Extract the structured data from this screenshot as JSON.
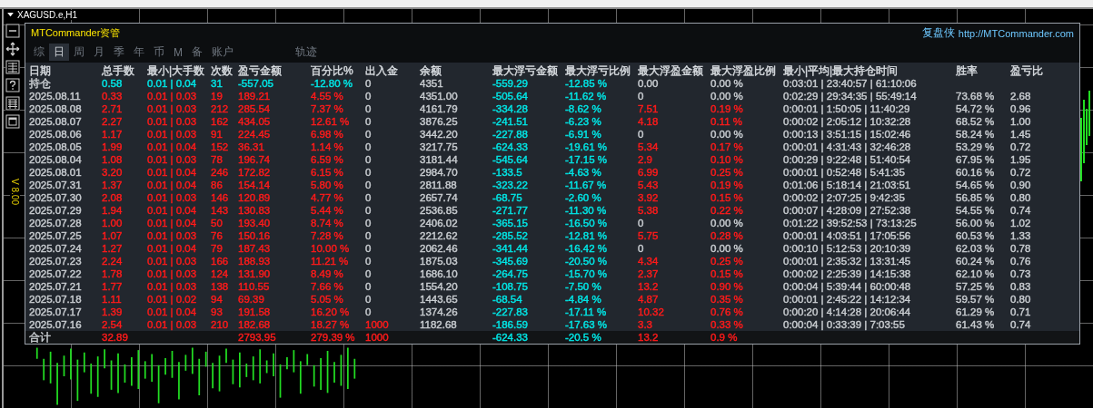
{
  "chart": {
    "title": "XAGUSD.e,H1",
    "volume_label": "V 8.00"
  },
  "panel": {
    "title": "MTCommander资管",
    "brand": "复盘侠",
    "link": "http://MTCommander.com"
  },
  "tabs": [
    {
      "label": "综",
      "selected": false
    },
    {
      "label": "日",
      "selected": true
    },
    {
      "label": "周",
      "selected": false
    },
    {
      "label": "月",
      "selected": false
    },
    {
      "label": "季",
      "selected": false
    },
    {
      "label": "年",
      "selected": false
    },
    {
      "label": "币",
      "selected": false
    },
    {
      "label": "M",
      "selected": false
    },
    {
      "label": "备",
      "selected": false
    },
    {
      "label": "账户",
      "selected": false
    },
    {
      "label": "轨迹",
      "selected": false
    }
  ],
  "table": {
    "columns": [
      "日期",
      "总手数",
      "最小|大手数",
      "次数",
      "盈亏金额",
      "百分比%",
      "出入金",
      "余额",
      "最大浮亏金额",
      "最大浮亏比例",
      "最大浮盈金额",
      "最大浮盈比例",
      "最小|平均|最大持仓时间",
      "胜率",
      "盈亏比"
    ],
    "rows": [
      {
        "kind": "position",
        "date": {
          "text": "持仓",
          "color": "#c8ccd0"
        },
        "lots": {
          "text": "0.58",
          "color": "#00e5e5"
        },
        "lot_range": {
          "text": "0.01 | 0.04",
          "color": "#00e5e5"
        },
        "trades": {
          "text": "31",
          "color": "#00e5e5"
        },
        "profit": {
          "text": "-557.05",
          "color": "#00e5e5"
        },
        "percent": {
          "text": "-12.80 %",
          "color": "#00e5e5"
        },
        "deposit": {
          "text": "0",
          "color": "#c8ccd0"
        },
        "balance": {
          "text": "4351",
          "color": "#c8ccd0"
        },
        "float_loss": {
          "text": "-559.29",
          "color": "#00e5e5"
        },
        "float_loss_pct": {
          "text": "-12.85 %",
          "color": "#00e5e5"
        },
        "float_profit": {
          "text": "0.00",
          "color": "#c8ccd0"
        },
        "float_profit_pct": {
          "text": "0.00 %",
          "color": "#c8ccd0"
        },
        "hold_times": {
          "text": "0:03:01 | 23:40:57 | 61:10:06",
          "color": "#c8ccd0"
        }
      },
      {
        "kind": "day",
        "date": {
          "text": "2025.08.11",
          "color": "#c8ccd0"
        },
        "lots": {
          "text": "0.33",
          "color": "#ff1a1a"
        },
        "lot_range": {
          "text": "0.01 | 0.03",
          "color": "#ff1a1a"
        },
        "trades": {
          "text": "19",
          "color": "#ff1a1a"
        },
        "profit": {
          "text": "189.21",
          "color": "#ff1a1a"
        },
        "percent": {
          "text": "4.55 %",
          "color": "#ff1a1a"
        },
        "deposit": {
          "text": "0",
          "color": "#c8ccd0"
        },
        "balance": {
          "text": "4351.00",
          "color": "#c8ccd0"
        },
        "float_loss": {
          "text": "-505.64",
          "color": "#00e5e5"
        },
        "float_loss_pct": {
          "text": "-11.62 %",
          "color": "#00e5e5"
        },
        "float_profit": {
          "text": "0",
          "color": "#c8ccd0"
        },
        "float_profit_pct": {
          "text": "0.00 %",
          "color": "#c8ccd0"
        },
        "hold_times": {
          "text": "0:02:29 | 29:34:35 | 55:49:14",
          "color": "#c8ccd0"
        },
        "win_rate": {
          "text": "73.68 %",
          "color": "#c8ccd0"
        },
        "ratio": {
          "text": "2.68",
          "color": "#c8ccd0"
        }
      },
      {
        "kind": "day",
        "date": {
          "text": "2025.08.08",
          "color": "#c8ccd0"
        },
        "lots": {
          "text": "2.71",
          "color": "#ff1a1a"
        },
        "lot_range": {
          "text": "0.01 | 0.03",
          "color": "#ff1a1a"
        },
        "trades": {
          "text": "212",
          "color": "#ff1a1a"
        },
        "profit": {
          "text": "285.54",
          "color": "#ff1a1a"
        },
        "percent": {
          "text": "7.37 %",
          "color": "#ff1a1a"
        },
        "deposit": {
          "text": "0",
          "color": "#c8ccd0"
        },
        "balance": {
          "text": "4161.79",
          "color": "#c8ccd0"
        },
        "float_loss": {
          "text": "-334.28",
          "color": "#00e5e5"
        },
        "float_loss_pct": {
          "text": "-8.62 %",
          "color": "#00e5e5"
        },
        "float_profit": {
          "text": "7.51",
          "color": "#ff1a1a"
        },
        "float_profit_pct": {
          "text": "0.19 %",
          "color": "#ff1a1a"
        },
        "hold_times": {
          "text": "0:00:01 | 1:50:05 | 11:40:29",
          "color": "#c8ccd0"
        },
        "win_rate": {
          "text": "54.72 %",
          "color": "#c8ccd0"
        },
        "ratio": {
          "text": "0.96",
          "color": "#c8ccd0"
        }
      },
      {
        "kind": "day",
        "date": {
          "text": "2025.08.07",
          "color": "#c8ccd0"
        },
        "lots": {
          "text": "2.27",
          "color": "#ff1a1a"
        },
        "lot_range": {
          "text": "0.01 | 0.03",
          "color": "#ff1a1a"
        },
        "trades": {
          "text": "162",
          "color": "#ff1a1a"
        },
        "profit": {
          "text": "434.05",
          "color": "#ff1a1a"
        },
        "percent": {
          "text": "12.61 %",
          "color": "#ff1a1a"
        },
        "deposit": {
          "text": "0",
          "color": "#c8ccd0"
        },
        "balance": {
          "text": "3876.25",
          "color": "#c8ccd0"
        },
        "float_loss": {
          "text": "-241.51",
          "color": "#00e5e5"
        },
        "float_loss_pct": {
          "text": "-6.23 %",
          "color": "#00e5e5"
        },
        "float_profit": {
          "text": "4.18",
          "color": "#ff1a1a"
        },
        "float_profit_pct": {
          "text": "0.11 %",
          "color": "#ff1a1a"
        },
        "hold_times": {
          "text": "0:00:02 | 2:05:12 | 10:32:28",
          "color": "#c8ccd0"
        },
        "win_rate": {
          "text": "68.52 %",
          "color": "#c8ccd0"
        },
        "ratio": {
          "text": "1.00",
          "color": "#c8ccd0"
        }
      },
      {
        "kind": "day",
        "date": {
          "text": "2025.08.06",
          "color": "#c8ccd0"
        },
        "lots": {
          "text": "1.17",
          "color": "#ff1a1a"
        },
        "lot_range": {
          "text": "0.01 | 0.03",
          "color": "#ff1a1a"
        },
        "trades": {
          "text": "91",
          "color": "#ff1a1a"
        },
        "profit": {
          "text": "224.45",
          "color": "#ff1a1a"
        },
        "percent": {
          "text": "6.98 %",
          "color": "#ff1a1a"
        },
        "deposit": {
          "text": "0",
          "color": "#c8ccd0"
        },
        "balance": {
          "text": "3442.20",
          "color": "#c8ccd0"
        },
        "float_loss": {
          "text": "-227.88",
          "color": "#00e5e5"
        },
        "float_loss_pct": {
          "text": "-6.91 %",
          "color": "#00e5e5"
        },
        "float_profit": {
          "text": "0",
          "color": "#c8ccd0"
        },
        "float_profit_pct": {
          "text": "0.00 %",
          "color": "#c8ccd0"
        },
        "hold_times": {
          "text": "0:00:13 | 3:51:15 | 15:02:46",
          "color": "#c8ccd0"
        },
        "win_rate": {
          "text": "58.24 %",
          "color": "#c8ccd0"
        },
        "ratio": {
          "text": "1.45",
          "color": "#c8ccd0"
        }
      },
      {
        "kind": "day",
        "date": {
          "text": "2025.08.05",
          "color": "#c8ccd0"
        },
        "lots": {
          "text": "1.99",
          "color": "#ff1a1a"
        },
        "lot_range": {
          "text": "0.01 | 0.04",
          "color": "#ff1a1a"
        },
        "trades": {
          "text": "152",
          "color": "#ff1a1a"
        },
        "profit": {
          "text": "36.31",
          "color": "#ff1a1a"
        },
        "percent": {
          "text": "1.14 %",
          "color": "#ff1a1a"
        },
        "deposit": {
          "text": "0",
          "color": "#c8ccd0"
        },
        "balance": {
          "text": "3217.75",
          "color": "#c8ccd0"
        },
        "float_loss": {
          "text": "-624.33",
          "color": "#00e5e5"
        },
        "float_loss_pct": {
          "text": "-19.61 %",
          "color": "#00e5e5"
        },
        "float_profit": {
          "text": "5.34",
          "color": "#ff1a1a"
        },
        "float_profit_pct": {
          "text": "0.17 %",
          "color": "#ff1a1a"
        },
        "hold_times": {
          "text": "0:00:01 | 4:31:43 | 32:46:28",
          "color": "#c8ccd0"
        },
        "win_rate": {
          "text": "53.29 %",
          "color": "#c8ccd0"
        },
        "ratio": {
          "text": "0.72",
          "color": "#c8ccd0"
        }
      },
      {
        "kind": "day",
        "date": {
          "text": "2025.08.04",
          "color": "#c8ccd0"
        },
        "lots": {
          "text": "1.08",
          "color": "#ff1a1a"
        },
        "lot_range": {
          "text": "0.01 | 0.03",
          "color": "#ff1a1a"
        },
        "trades": {
          "text": "78",
          "color": "#ff1a1a"
        },
        "profit": {
          "text": "196.74",
          "color": "#ff1a1a"
        },
        "percent": {
          "text": "6.59 %",
          "color": "#ff1a1a"
        },
        "deposit": {
          "text": "0",
          "color": "#c8ccd0"
        },
        "balance": {
          "text": "3181.44",
          "color": "#c8ccd0"
        },
        "float_loss": {
          "text": "-545.64",
          "color": "#00e5e5"
        },
        "float_loss_pct": {
          "text": "-17.15 %",
          "color": "#00e5e5"
        },
        "float_profit": {
          "text": "2.9",
          "color": "#ff1a1a"
        },
        "float_profit_pct": {
          "text": "0.10 %",
          "color": "#ff1a1a"
        },
        "hold_times": {
          "text": "0:00:29 | 9:22:48 | 51:40:54",
          "color": "#c8ccd0"
        },
        "win_rate": {
          "text": "67.95 %",
          "color": "#c8ccd0"
        },
        "ratio": {
          "text": "1.95",
          "color": "#c8ccd0"
        }
      },
      {
        "kind": "day",
        "date": {
          "text": "2025.08.01",
          "color": "#c8ccd0"
        },
        "lots": {
          "text": "3.20",
          "color": "#ff1a1a"
        },
        "lot_range": {
          "text": "0.01 | 0.04",
          "color": "#ff1a1a"
        },
        "trades": {
          "text": "246",
          "color": "#ff1a1a"
        },
        "profit": {
          "text": "172.82",
          "color": "#ff1a1a"
        },
        "percent": {
          "text": "6.15 %",
          "color": "#ff1a1a"
        },
        "deposit": {
          "text": "0",
          "color": "#c8ccd0"
        },
        "balance": {
          "text": "2984.70",
          "color": "#c8ccd0"
        },
        "float_loss": {
          "text": "-133.5",
          "color": "#00e5e5"
        },
        "float_loss_pct": {
          "text": "-4.63 %",
          "color": "#00e5e5"
        },
        "float_profit": {
          "text": "6.99",
          "color": "#ff1a1a"
        },
        "float_profit_pct": {
          "text": "0.25 %",
          "color": "#ff1a1a"
        },
        "hold_times": {
          "text": "0:00:01 | 0:52:48 | 5:41:35",
          "color": "#c8ccd0"
        },
        "win_rate": {
          "text": "60.16 %",
          "color": "#c8ccd0"
        },
        "ratio": {
          "text": "0.72",
          "color": "#c8ccd0"
        }
      },
      {
        "kind": "day",
        "date": {
          "text": "2025.07.31",
          "color": "#c8ccd0"
        },
        "lots": {
          "text": "1.37",
          "color": "#ff1a1a"
        },
        "lot_range": {
          "text": "0.01 | 0.04",
          "color": "#ff1a1a"
        },
        "trades": {
          "text": "86",
          "color": "#ff1a1a"
        },
        "profit": {
          "text": "154.14",
          "color": "#ff1a1a"
        },
        "percent": {
          "text": "5.80 %",
          "color": "#ff1a1a"
        },
        "deposit": {
          "text": "0",
          "color": "#c8ccd0"
        },
        "balance": {
          "text": "2811.88",
          "color": "#c8ccd0"
        },
        "float_loss": {
          "text": "-323.22",
          "color": "#00e5e5"
        },
        "float_loss_pct": {
          "text": "-11.67 %",
          "color": "#00e5e5"
        },
        "float_profit": {
          "text": "5.43",
          "color": "#ff1a1a"
        },
        "float_profit_pct": {
          "text": "0.19 %",
          "color": "#ff1a1a"
        },
        "hold_times": {
          "text": "0:01:06 | 5:18:14 | 21:03:51",
          "color": "#c8ccd0"
        },
        "win_rate": {
          "text": "54.65 %",
          "color": "#c8ccd0"
        },
        "ratio": {
          "text": "0.90",
          "color": "#c8ccd0"
        }
      },
      {
        "kind": "day",
        "date": {
          "text": "2025.07.30",
          "color": "#c8ccd0"
        },
        "lots": {
          "text": "2.08",
          "color": "#ff1a1a"
        },
        "lot_range": {
          "text": "0.01 | 0.03",
          "color": "#ff1a1a"
        },
        "trades": {
          "text": "146",
          "color": "#ff1a1a"
        },
        "profit": {
          "text": "120.89",
          "color": "#ff1a1a"
        },
        "percent": {
          "text": "4.77 %",
          "color": "#ff1a1a"
        },
        "deposit": {
          "text": "0",
          "color": "#c8ccd0"
        },
        "balance": {
          "text": "2657.74",
          "color": "#c8ccd0"
        },
        "float_loss": {
          "text": "-68.75",
          "color": "#00e5e5"
        },
        "float_loss_pct": {
          "text": "-2.60 %",
          "color": "#00e5e5"
        },
        "float_profit": {
          "text": "3.92",
          "color": "#ff1a1a"
        },
        "float_profit_pct": {
          "text": "0.15 %",
          "color": "#ff1a1a"
        },
        "hold_times": {
          "text": "0:00:02 | 2:07:25 | 9:42:35",
          "color": "#c8ccd0"
        },
        "win_rate": {
          "text": "56.85 %",
          "color": "#c8ccd0"
        },
        "ratio": {
          "text": "0.80",
          "color": "#c8ccd0"
        }
      },
      {
        "kind": "day",
        "date": {
          "text": "2025.07.29",
          "color": "#c8ccd0"
        },
        "lots": {
          "text": "1.94",
          "color": "#ff1a1a"
        },
        "lot_range": {
          "text": "0.01 | 0.04",
          "color": "#ff1a1a"
        },
        "trades": {
          "text": "143",
          "color": "#ff1a1a"
        },
        "profit": {
          "text": "130.83",
          "color": "#ff1a1a"
        },
        "percent": {
          "text": "5.44 %",
          "color": "#ff1a1a"
        },
        "deposit": {
          "text": "0",
          "color": "#c8ccd0"
        },
        "balance": {
          "text": "2536.85",
          "color": "#c8ccd0"
        },
        "float_loss": {
          "text": "-271.77",
          "color": "#00e5e5"
        },
        "float_loss_pct": {
          "text": "-11.30 %",
          "color": "#00e5e5"
        },
        "float_profit": {
          "text": "5.38",
          "color": "#ff1a1a"
        },
        "float_profit_pct": {
          "text": "0.22 %",
          "color": "#ff1a1a"
        },
        "hold_times": {
          "text": "0:00:07 | 4:28:09 | 27:52:38",
          "color": "#c8ccd0"
        },
        "win_rate": {
          "text": "54.55 %",
          "color": "#c8ccd0"
        },
        "ratio": {
          "text": "0.74",
          "color": "#c8ccd0"
        }
      },
      {
        "kind": "day",
        "date": {
          "text": "2025.07.28",
          "color": "#c8ccd0"
        },
        "lots": {
          "text": "1.00",
          "color": "#ff1a1a"
        },
        "lot_range": {
          "text": "0.01 | 0.04",
          "color": "#ff1a1a"
        },
        "trades": {
          "text": "50",
          "color": "#ff1a1a"
        },
        "profit": {
          "text": "193.40",
          "color": "#ff1a1a"
        },
        "percent": {
          "text": "8.74 %",
          "color": "#ff1a1a"
        },
        "deposit": {
          "text": "0",
          "color": "#c8ccd0"
        },
        "balance": {
          "text": "2406.02",
          "color": "#c8ccd0"
        },
        "float_loss": {
          "text": "-365.15",
          "color": "#00e5e5"
        },
        "float_loss_pct": {
          "text": "-16.50 %",
          "color": "#00e5e5"
        },
        "float_profit": {
          "text": "0",
          "color": "#c8ccd0"
        },
        "float_profit_pct": {
          "text": "0.00 %",
          "color": "#c8ccd0"
        },
        "hold_times": {
          "text": "0:01:22 | 39:52:53 | 73:13:25",
          "color": "#c8ccd0"
        },
        "win_rate": {
          "text": "56.00 %",
          "color": "#c8ccd0"
        },
        "ratio": {
          "text": "1.02",
          "color": "#c8ccd0"
        }
      },
      {
        "kind": "day",
        "date": {
          "text": "2025.07.25",
          "color": "#c8ccd0"
        },
        "lots": {
          "text": "1.07",
          "color": "#ff1a1a"
        },
        "lot_range": {
          "text": "0.01 | 0.03",
          "color": "#ff1a1a"
        },
        "trades": {
          "text": "76",
          "color": "#ff1a1a"
        },
        "profit": {
          "text": "150.16",
          "color": "#ff1a1a"
        },
        "percent": {
          "text": "7.28 %",
          "color": "#ff1a1a"
        },
        "deposit": {
          "text": "0",
          "color": "#c8ccd0"
        },
        "balance": {
          "text": "2212.62",
          "color": "#c8ccd0"
        },
        "float_loss": {
          "text": "-285.52",
          "color": "#00e5e5"
        },
        "float_loss_pct": {
          "text": "-12.81 %",
          "color": "#00e5e5"
        },
        "float_profit": {
          "text": "5.75",
          "color": "#ff1a1a"
        },
        "float_profit_pct": {
          "text": "0.28 %",
          "color": "#ff1a1a"
        },
        "hold_times": {
          "text": "0:00:01 | 4:03:51 | 17:05:56",
          "color": "#c8ccd0"
        },
        "win_rate": {
          "text": "60.53 %",
          "color": "#c8ccd0"
        },
        "ratio": {
          "text": "1.33",
          "color": "#c8ccd0"
        }
      },
      {
        "kind": "day",
        "date": {
          "text": "2025.07.24",
          "color": "#c8ccd0"
        },
        "lots": {
          "text": "1.27",
          "color": "#ff1a1a"
        },
        "lot_range": {
          "text": "0.01 | 0.04",
          "color": "#ff1a1a"
        },
        "trades": {
          "text": "79",
          "color": "#ff1a1a"
        },
        "profit": {
          "text": "187.43",
          "color": "#ff1a1a"
        },
        "percent": {
          "text": "10.00 %",
          "color": "#ff1a1a"
        },
        "deposit": {
          "text": "0",
          "color": "#c8ccd0"
        },
        "balance": {
          "text": "2062.46",
          "color": "#c8ccd0"
        },
        "float_loss": {
          "text": "-341.44",
          "color": "#00e5e5"
        },
        "float_loss_pct": {
          "text": "-16.42 %",
          "color": "#00e5e5"
        },
        "float_profit": {
          "text": "0",
          "color": "#c8ccd0"
        },
        "float_profit_pct": {
          "text": "0.00 %",
          "color": "#c8ccd0"
        },
        "hold_times": {
          "text": "0:00:10 | 5:12:53 | 20:10:39",
          "color": "#c8ccd0"
        },
        "win_rate": {
          "text": "62.03 %",
          "color": "#c8ccd0"
        },
        "ratio": {
          "text": "0.78",
          "color": "#c8ccd0"
        }
      },
      {
        "kind": "day",
        "date": {
          "text": "2025.07.23",
          "color": "#c8ccd0"
        },
        "lots": {
          "text": "2.24",
          "color": "#ff1a1a"
        },
        "lot_range": {
          "text": "0.01 | 0.03",
          "color": "#ff1a1a"
        },
        "trades": {
          "text": "166",
          "color": "#ff1a1a"
        },
        "profit": {
          "text": "188.93",
          "color": "#ff1a1a"
        },
        "percent": {
          "text": "11.21 %",
          "color": "#ff1a1a"
        },
        "deposit": {
          "text": "0",
          "color": "#c8ccd0"
        },
        "balance": {
          "text": "1875.03",
          "color": "#c8ccd0"
        },
        "float_loss": {
          "text": "-345.69",
          "color": "#00e5e5"
        },
        "float_loss_pct": {
          "text": "-20.50 %",
          "color": "#00e5e5"
        },
        "float_profit": {
          "text": "4.34",
          "color": "#ff1a1a"
        },
        "float_profit_pct": {
          "text": "0.25 %",
          "color": "#ff1a1a"
        },
        "hold_times": {
          "text": "0:00:01 | 2:35:32 | 13:31:45",
          "color": "#c8ccd0"
        },
        "win_rate": {
          "text": "60.24 %",
          "color": "#c8ccd0"
        },
        "ratio": {
          "text": "0.76",
          "color": "#c8ccd0"
        }
      },
      {
        "kind": "day",
        "date": {
          "text": "2025.07.22",
          "color": "#c8ccd0"
        },
        "lots": {
          "text": "1.78",
          "color": "#ff1a1a"
        },
        "lot_range": {
          "text": "0.01 | 0.03",
          "color": "#ff1a1a"
        },
        "trades": {
          "text": "124",
          "color": "#ff1a1a"
        },
        "profit": {
          "text": "131.90",
          "color": "#ff1a1a"
        },
        "percent": {
          "text": "8.49 %",
          "color": "#ff1a1a"
        },
        "deposit": {
          "text": "0",
          "color": "#c8ccd0"
        },
        "balance": {
          "text": "1686.10",
          "color": "#c8ccd0"
        },
        "float_loss": {
          "text": "-264.75",
          "color": "#00e5e5"
        },
        "float_loss_pct": {
          "text": "-15.70 %",
          "color": "#00e5e5"
        },
        "float_profit": {
          "text": "2.37",
          "color": "#ff1a1a"
        },
        "float_profit_pct": {
          "text": "0.15 %",
          "color": "#ff1a1a"
        },
        "hold_times": {
          "text": "0:00:02 | 2:25:39 | 14:15:38",
          "color": "#c8ccd0"
        },
        "win_rate": {
          "text": "62.10 %",
          "color": "#c8ccd0"
        },
        "ratio": {
          "text": "0.73",
          "color": "#c8ccd0"
        }
      },
      {
        "kind": "day",
        "date": {
          "text": "2025.07.21",
          "color": "#c8ccd0"
        },
        "lots": {
          "text": "1.77",
          "color": "#ff1a1a"
        },
        "lot_range": {
          "text": "0.01 | 0.03",
          "color": "#ff1a1a"
        },
        "trades": {
          "text": "138",
          "color": "#ff1a1a"
        },
        "profit": {
          "text": "110.55",
          "color": "#ff1a1a"
        },
        "percent": {
          "text": "7.66 %",
          "color": "#ff1a1a"
        },
        "deposit": {
          "text": "0",
          "color": "#c8ccd0"
        },
        "balance": {
          "text": "1554.20",
          "color": "#c8ccd0"
        },
        "float_loss": {
          "text": "-108.75",
          "color": "#00e5e5"
        },
        "float_loss_pct": {
          "text": "-7.50 %",
          "color": "#00e5e5"
        },
        "float_profit": {
          "text": "13.2",
          "color": "#ff1a1a"
        },
        "float_profit_pct": {
          "text": "0.90 %",
          "color": "#ff1a1a"
        },
        "hold_times": {
          "text": "0:00:04 | 5:39:44 | 60:00:48",
          "color": "#c8ccd0"
        },
        "win_rate": {
          "text": "57.25 %",
          "color": "#c8ccd0"
        },
        "ratio": {
          "text": "0.83",
          "color": "#c8ccd0"
        }
      },
      {
        "kind": "day",
        "date": {
          "text": "2025.07.18",
          "color": "#c8ccd0"
        },
        "lots": {
          "text": "1.11",
          "color": "#ff1a1a"
        },
        "lot_range": {
          "text": "0.01 | 0.02",
          "color": "#ff1a1a"
        },
        "trades": {
          "text": "94",
          "color": "#ff1a1a"
        },
        "profit": {
          "text": "69.39",
          "color": "#ff1a1a"
        },
        "percent": {
          "text": "5.05 %",
          "color": "#ff1a1a"
        },
        "deposit": {
          "text": "0",
          "color": "#c8ccd0"
        },
        "balance": {
          "text": "1443.65",
          "color": "#c8ccd0"
        },
        "float_loss": {
          "text": "-68.54",
          "color": "#00e5e5"
        },
        "float_loss_pct": {
          "text": "-4.84 %",
          "color": "#00e5e5"
        },
        "float_profit": {
          "text": "4.87",
          "color": "#ff1a1a"
        },
        "float_profit_pct": {
          "text": "0.35 %",
          "color": "#ff1a1a"
        },
        "hold_times": {
          "text": "0:00:01 | 2:45:22 | 14:12:34",
          "color": "#c8ccd0"
        },
        "win_rate": {
          "text": "59.57 %",
          "color": "#c8ccd0"
        },
        "ratio": {
          "text": "0.80",
          "color": "#c8ccd0"
        }
      },
      {
        "kind": "day",
        "date": {
          "text": "2025.07.17",
          "color": "#c8ccd0"
        },
        "lots": {
          "text": "1.39",
          "color": "#ff1a1a"
        },
        "lot_range": {
          "text": "0.01 | 0.04",
          "color": "#ff1a1a"
        },
        "trades": {
          "text": "93",
          "color": "#ff1a1a"
        },
        "profit": {
          "text": "191.58",
          "color": "#ff1a1a"
        },
        "percent": {
          "text": "16.20 %",
          "color": "#ff1a1a"
        },
        "deposit": {
          "text": "0",
          "color": "#c8ccd0"
        },
        "balance": {
          "text": "1374.26",
          "color": "#c8ccd0"
        },
        "float_loss": {
          "text": "-227.83",
          "color": "#00e5e5"
        },
        "float_loss_pct": {
          "text": "-17.11 %",
          "color": "#00e5e5"
        },
        "float_profit": {
          "text": "10.32",
          "color": "#ff1a1a"
        },
        "float_profit_pct": {
          "text": "0.76 %",
          "color": "#ff1a1a"
        },
        "hold_times": {
          "text": "0:00:20 | 4:14:28 | 20:06:44",
          "color": "#c8ccd0"
        },
        "win_rate": {
          "text": "61.29 %",
          "color": "#c8ccd0"
        },
        "ratio": {
          "text": "0.71",
          "color": "#c8ccd0"
        }
      },
      {
        "kind": "day",
        "date": {
          "text": "2025.07.16",
          "color": "#c8ccd0"
        },
        "lots": {
          "text": "2.54",
          "color": "#ff1a1a"
        },
        "lot_range": {
          "text": "0.01 | 0.03",
          "color": "#ff1a1a"
        },
        "trades": {
          "text": "210",
          "color": "#ff1a1a"
        },
        "profit": {
          "text": "182.68",
          "color": "#ff1a1a"
        },
        "percent": {
          "text": "18.27 %",
          "color": "#ff1a1a"
        },
        "deposit": {
          "text": "1000",
          "color": "#ff1a1a"
        },
        "balance": {
          "text": "1182.68",
          "color": "#c8ccd0"
        },
        "float_loss": {
          "text": "-186.59",
          "color": "#00e5e5"
        },
        "float_loss_pct": {
          "text": "-17.63 %",
          "color": "#00e5e5"
        },
        "float_profit": {
          "text": "3.3",
          "color": "#ff1a1a"
        },
        "float_profit_pct": {
          "text": "0.33 %",
          "color": "#ff1a1a"
        },
        "hold_times": {
          "text": "0:00:04 | 0:33:39 | 7:03:55",
          "color": "#c8ccd0"
        },
        "win_rate": {
          "text": "61.43 %",
          "color": "#c8ccd0"
        },
        "ratio": {
          "text": "0.74",
          "color": "#c8ccd0"
        }
      },
      {
        "kind": "total",
        "date": {
          "text": "合计",
          "color": "#c8ccd0"
        },
        "lots": {
          "text": "32.89",
          "color": "#ff1a1a"
        },
        "profit": {
          "text": "2793.95",
          "color": "#ff1a1a"
        },
        "percent": {
          "text": "279.39 %",
          "color": "#ff1a1a"
        },
        "deposit": {
          "text": "1000",
          "color": "#ff1a1a"
        },
        "float_loss": {
          "text": "-624.33",
          "color": "#00e5e5"
        },
        "float_loss_pct": {
          "text": "-20.5 %",
          "color": "#00e5e5"
        },
        "float_profit": {
          "text": "13.2",
          "color": "#ff1a1a"
        },
        "float_profit_pct": {
          "text": "0.9 %",
          "color": "#ff1a1a"
        }
      }
    ]
  }
}
